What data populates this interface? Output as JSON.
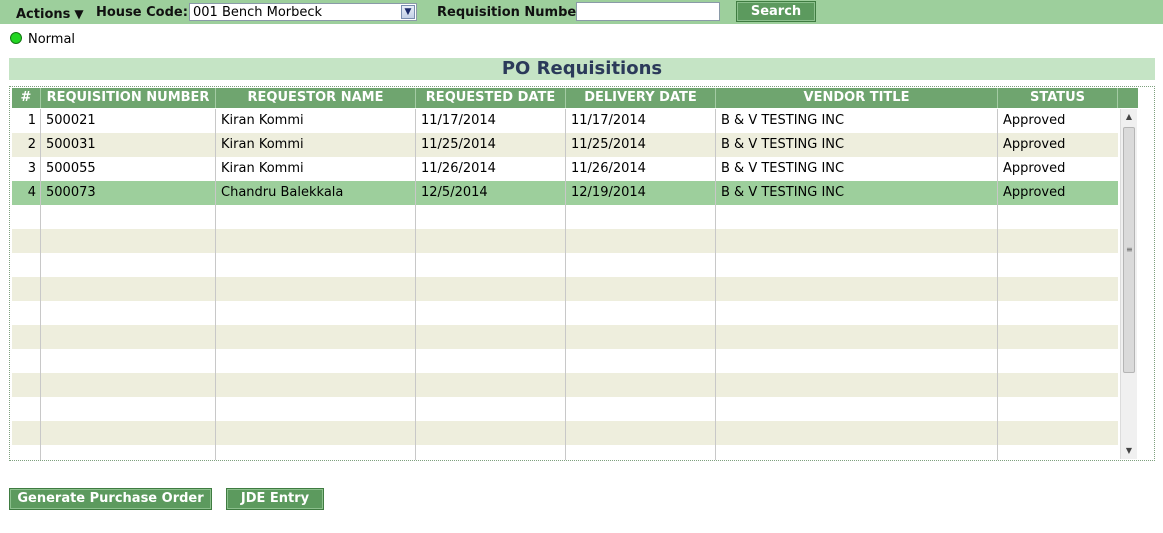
{
  "toolbar": {
    "actions_label": "Actions",
    "house_code_label": "House Code:",
    "house_code_value": "001 Bench Morbeck",
    "requisition_number_label": "Requisition Number:",
    "requisition_number_value": "",
    "search_label": "Search"
  },
  "status": {
    "label": "Normal",
    "color": "#22d622"
  },
  "title": "PO Requisitions",
  "grid": {
    "columns": [
      "#",
      "REQUISITION NUMBER",
      "REQUESTOR NAME",
      "REQUESTED DATE",
      "DELIVERY DATE",
      "VENDOR TITLE",
      "STATUS"
    ],
    "rows": [
      [
        "1",
        "500021",
        "Kiran Kommi",
        "11/17/2014",
        "11/17/2014",
        "B & V TESTING INC",
        "Approved"
      ],
      [
        "2",
        "500031",
        "Kiran Kommi",
        "11/25/2014",
        "11/25/2014",
        "B & V TESTING INC",
        "Approved"
      ],
      [
        "3",
        "500055",
        "Kiran Kommi",
        "11/26/2014",
        "11/26/2014",
        "B & V TESTING INC",
        "Approved"
      ],
      [
        "4",
        "500073",
        "Chandru Balekkala",
        "12/5/2014",
        "12/19/2014",
        "B & V TESTING INC",
        "Approved"
      ]
    ],
    "selected_row": 4
  },
  "buttons": {
    "generate_po": "Generate Purchase Order",
    "jde_entry": "JDE Entry"
  },
  "colors": {
    "header_bar": "#9dcf9c",
    "grid_header": "#6fa56f",
    "selected_row": "#9dcf9c",
    "alt_row": "#eeeedd",
    "button": "#5c9a5e"
  }
}
